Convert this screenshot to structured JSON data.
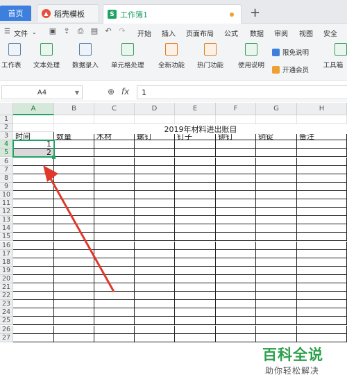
{
  "tabs": {
    "home": "首页",
    "template": "稻壳模板",
    "workbook": "工作簿1",
    "workbook_icon": "S",
    "new_tab": "+"
  },
  "menu": {
    "file": "文件",
    "items": [
      "开始",
      "插入",
      "页面布局",
      "公式",
      "数据",
      "审阅",
      "视图",
      "安全"
    ]
  },
  "ribbon": {
    "worksheet": "工作表",
    "text_processing": "文本处理",
    "data_entry": "数据录入",
    "cell_processing": "单元格处理",
    "new_features": "全新功能",
    "hot_features": "热门功能",
    "usage_guide": "使用说明",
    "free_limit": "限免说明",
    "open_member": "开通会员",
    "toolbox": "工具箱"
  },
  "formula_bar": {
    "cell_ref": "A4",
    "value": "1"
  },
  "columns": [
    "A",
    "B",
    "C",
    "D",
    "E",
    "F",
    "G",
    "H"
  ],
  "rows": [
    "1",
    "2",
    "3",
    "4",
    "5",
    "6",
    "7",
    "8",
    "9",
    "10",
    "11",
    "12",
    "13",
    "14",
    "15",
    "16",
    "17",
    "18",
    "19",
    "20",
    "21",
    "22",
    "23",
    "24",
    "25",
    "26",
    "27"
  ],
  "sheet": {
    "title": "2019年材料进出账目",
    "headers": [
      "时间",
      "数量",
      "木材",
      "螺钉",
      "钉子",
      "铆钉",
      "铜锭",
      "备注"
    ],
    "a4": "1",
    "a5": "2"
  },
  "watermark": {
    "title": "百科全说",
    "subtitle": "助你轻松解决"
  },
  "colors": {
    "accent": "#21a366",
    "home_tab": "#3d7fdf",
    "arrow": "#e0392b"
  }
}
